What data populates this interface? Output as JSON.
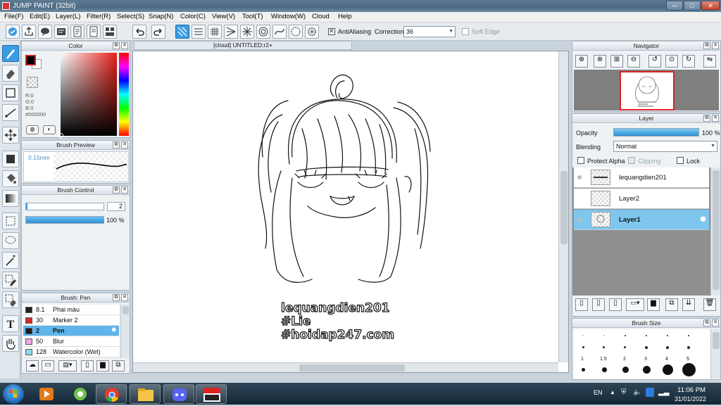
{
  "window": {
    "title": "JUMP PAINT (32bit)",
    "minimize": "─",
    "maximize": "□",
    "close": "✕"
  },
  "menu": [
    "File(F)",
    "Edit(E)",
    "Layer(L)",
    "Filter(R)",
    "Select(S)",
    "Snap(N)",
    "Color(C)",
    "View(V)",
    "Tool(T)",
    "Window(W)",
    "Cloud",
    "Help"
  ],
  "toolbar": {
    "antialiasing_label": "AntiAliasing",
    "correction_label": "Correction",
    "correction_value": "36",
    "softedge_label": "Soft Edge"
  },
  "color_panel": {
    "title": "Color",
    "r": "R:0",
    "g": "G:0",
    "b": "B:0",
    "hex": "#000000",
    "fg": "#000000",
    "bg": "#ffffff"
  },
  "brush_preview": {
    "title": "Brush Preview",
    "size": "0.15mm"
  },
  "brush_control": {
    "title": "Brush Control",
    "size_value": "2",
    "opacity_value": "100 %",
    "opacity_fraction": 1.0
  },
  "brush_list": {
    "title": "Brush: Pen",
    "items": [
      {
        "size": "8.1",
        "name": "Phai màu",
        "color": "#222222"
      },
      {
        "size": "30",
        "name": "Marker 2",
        "color": "#d42a2a"
      },
      {
        "size": "2",
        "name": "Pen",
        "color": "#1a1a1a",
        "selected": true
      },
      {
        "size": "50",
        "name": "Blur",
        "color": "#f2a6e6"
      },
      {
        "size": "128",
        "name": "Watercolor (Wet)",
        "color": "#8fd8f0"
      }
    ]
  },
  "canvas": {
    "tab_title": "[cloud] UNTITLED:r2+",
    "text_lines": [
      "lequangdien201",
      "#Lie",
      "#hoidap247.com"
    ]
  },
  "navigator": {
    "title": "Navigator"
  },
  "layer_panel": {
    "title": "Layer",
    "opacity_label": "Opacity",
    "opacity_value": "100 %",
    "blending_label": "Blending",
    "blending_value": "Normal",
    "protect_alpha": "Protect Alpha",
    "clipping": "Clipping",
    "lock": "Lock",
    "layers": [
      {
        "name": "lequangdien201",
        "selected": false
      },
      {
        "name": "Layer2",
        "selected": false
      },
      {
        "name": "Layer1",
        "selected": true
      }
    ]
  },
  "brush_size": {
    "title": "Brush Size",
    "labels": [
      "1",
      "1.5",
      "2",
      "3",
      "4",
      "5"
    ]
  },
  "taskbar": {
    "language": "EN",
    "time": "11:06 PM",
    "date": "31/01/2022"
  }
}
